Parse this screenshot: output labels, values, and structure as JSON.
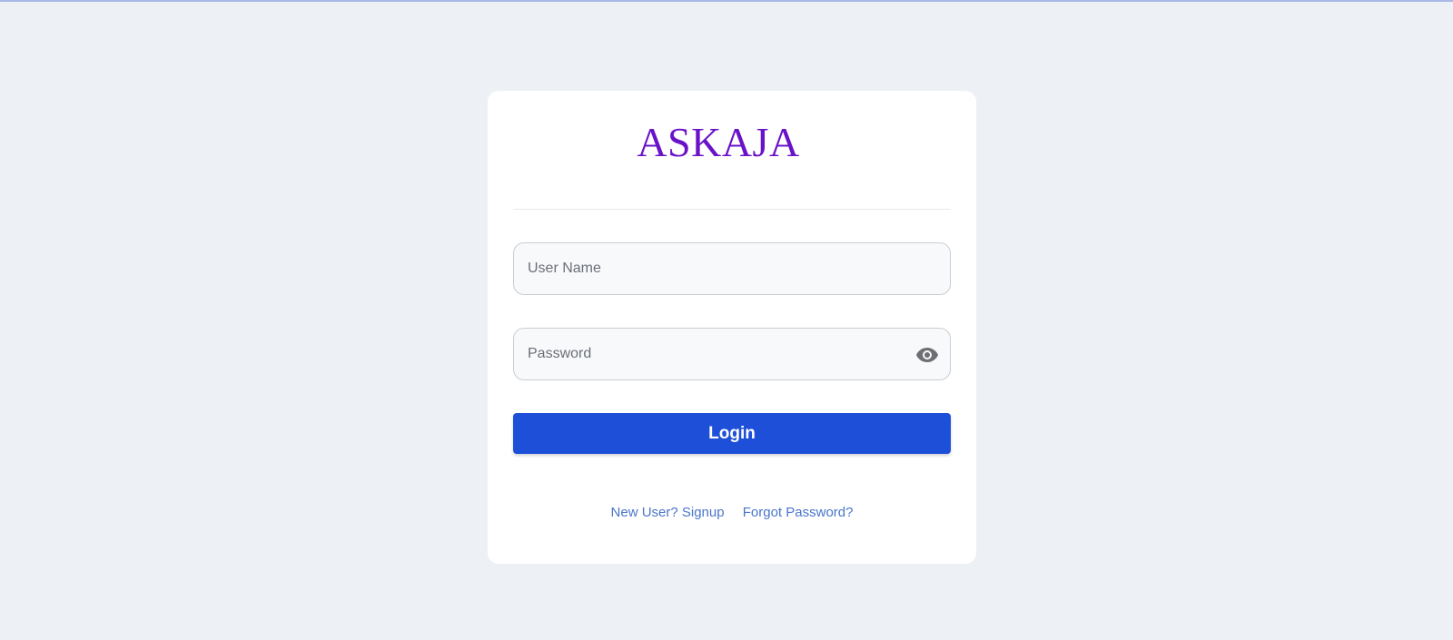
{
  "brand": {
    "name": "ASKAJA",
    "color": "#6a12c8"
  },
  "form": {
    "username": {
      "placeholder": "User Name",
      "value": ""
    },
    "password": {
      "placeholder": "Password",
      "value": "",
      "toggle_icon": "eye-icon"
    },
    "login_label": "Login",
    "login_color": "#1d4fd8"
  },
  "links": {
    "signup": "New User? Signup",
    "forgot": "Forgot Password?",
    "color": "#4a76c9"
  }
}
